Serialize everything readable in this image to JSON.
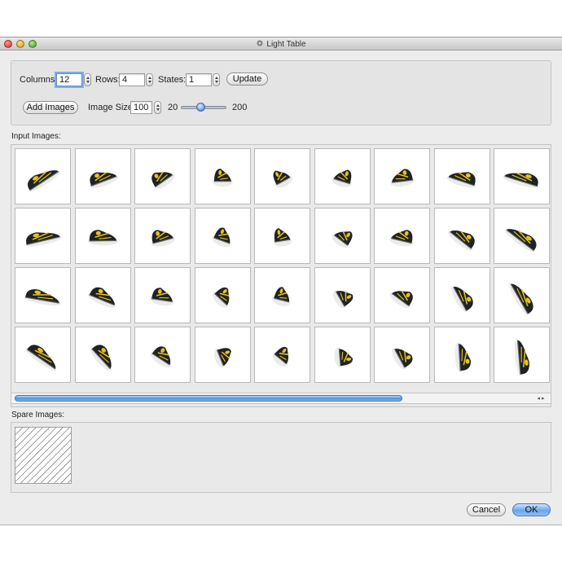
{
  "window": {
    "title": "Light Table"
  },
  "controls": {
    "columns_label": "Columns:",
    "columns_value": "12",
    "rows_label": "Rows:",
    "rows_value": "4",
    "states_label": "States:",
    "states_value": "1",
    "update_label": "Update",
    "add_images_label": "Add Images",
    "image_size_label": "Image Size:",
    "image_size_value": "100",
    "slider_min": "20",
    "slider_max": "200",
    "slider_value": 100
  },
  "input_images": {
    "label": "Input Images:",
    "visible_columns": 9,
    "rows": 4,
    "icon": "sneaker-thumbnail",
    "accent_yellow": "#e8c41a",
    "shoe_color": "#1f2326"
  },
  "spare_images": {
    "label": "Spare Images:",
    "placeholder_icon": "hatched-placeholder-icon"
  },
  "buttons": {
    "cancel": "Cancel",
    "ok": "OK"
  },
  "colors": {
    "accent": "#5b8fd6",
    "window_bg": "#ececec"
  }
}
